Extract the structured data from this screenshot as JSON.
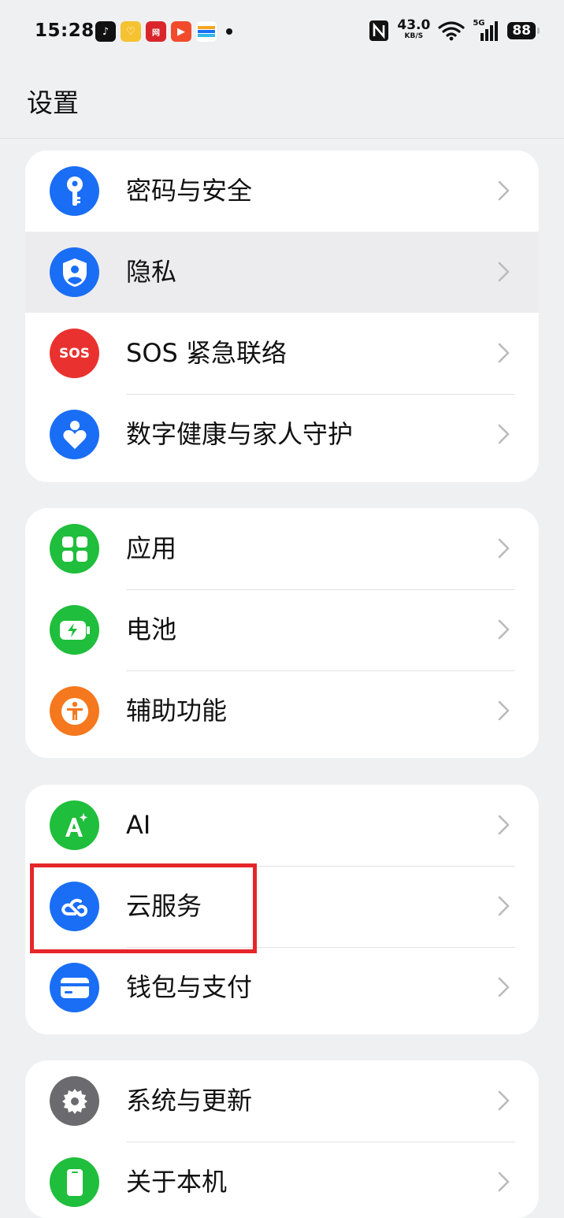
{
  "status_bar": {
    "time": "15:28",
    "network_speed": "43.0",
    "network_speed_unit": "KB/S",
    "signal_label": "5G",
    "battery": "88",
    "app_icons": [
      "douyin-app-icon",
      "yellow-app-icon",
      "netease-app-icon",
      "video-app-icon",
      "wallet-app-icon"
    ]
  },
  "header": {
    "title": "设置"
  },
  "groups": [
    {
      "items": [
        {
          "label": "密码与安全",
          "icon": "key-icon",
          "color": "#1a6ef5"
        },
        {
          "label": "隐私",
          "icon": "privacy-shield-icon",
          "color": "#1a6ef5"
        },
        {
          "label": "SOS 紧急联络",
          "icon": "sos-icon",
          "icon_text": "SOS",
          "color": "#e9322f"
        },
        {
          "label": "数字健康与家人守护",
          "icon": "digital-health-icon",
          "color": "#1a6ef5"
        }
      ]
    },
    {
      "items": [
        {
          "label": "应用",
          "icon": "apps-grid-icon",
          "color": "#1fbe3c"
        },
        {
          "label": "电池",
          "icon": "battery-icon",
          "color": "#1fbe3c"
        },
        {
          "label": "辅助功能",
          "icon": "accessibility-icon",
          "color": "#f5781e"
        }
      ]
    },
    {
      "items": [
        {
          "label": "AI",
          "icon": "ai-icon",
          "color": "#1fbe3c"
        },
        {
          "label": "云服务",
          "icon": "cloud-service-icon",
          "color": "#1a6ef5"
        },
        {
          "label": "钱包与支付",
          "icon": "wallet-icon",
          "color": "#1a6ef5"
        }
      ]
    },
    {
      "items": [
        {
          "label": "系统与更新",
          "icon": "gear-icon",
          "color": "#6b6b6f"
        },
        {
          "label": "关于本机",
          "icon": "phone-icon",
          "color": "#1fbe3c"
        }
      ]
    }
  ],
  "colors": {
    "highlight_annotation": "#e5262a"
  }
}
